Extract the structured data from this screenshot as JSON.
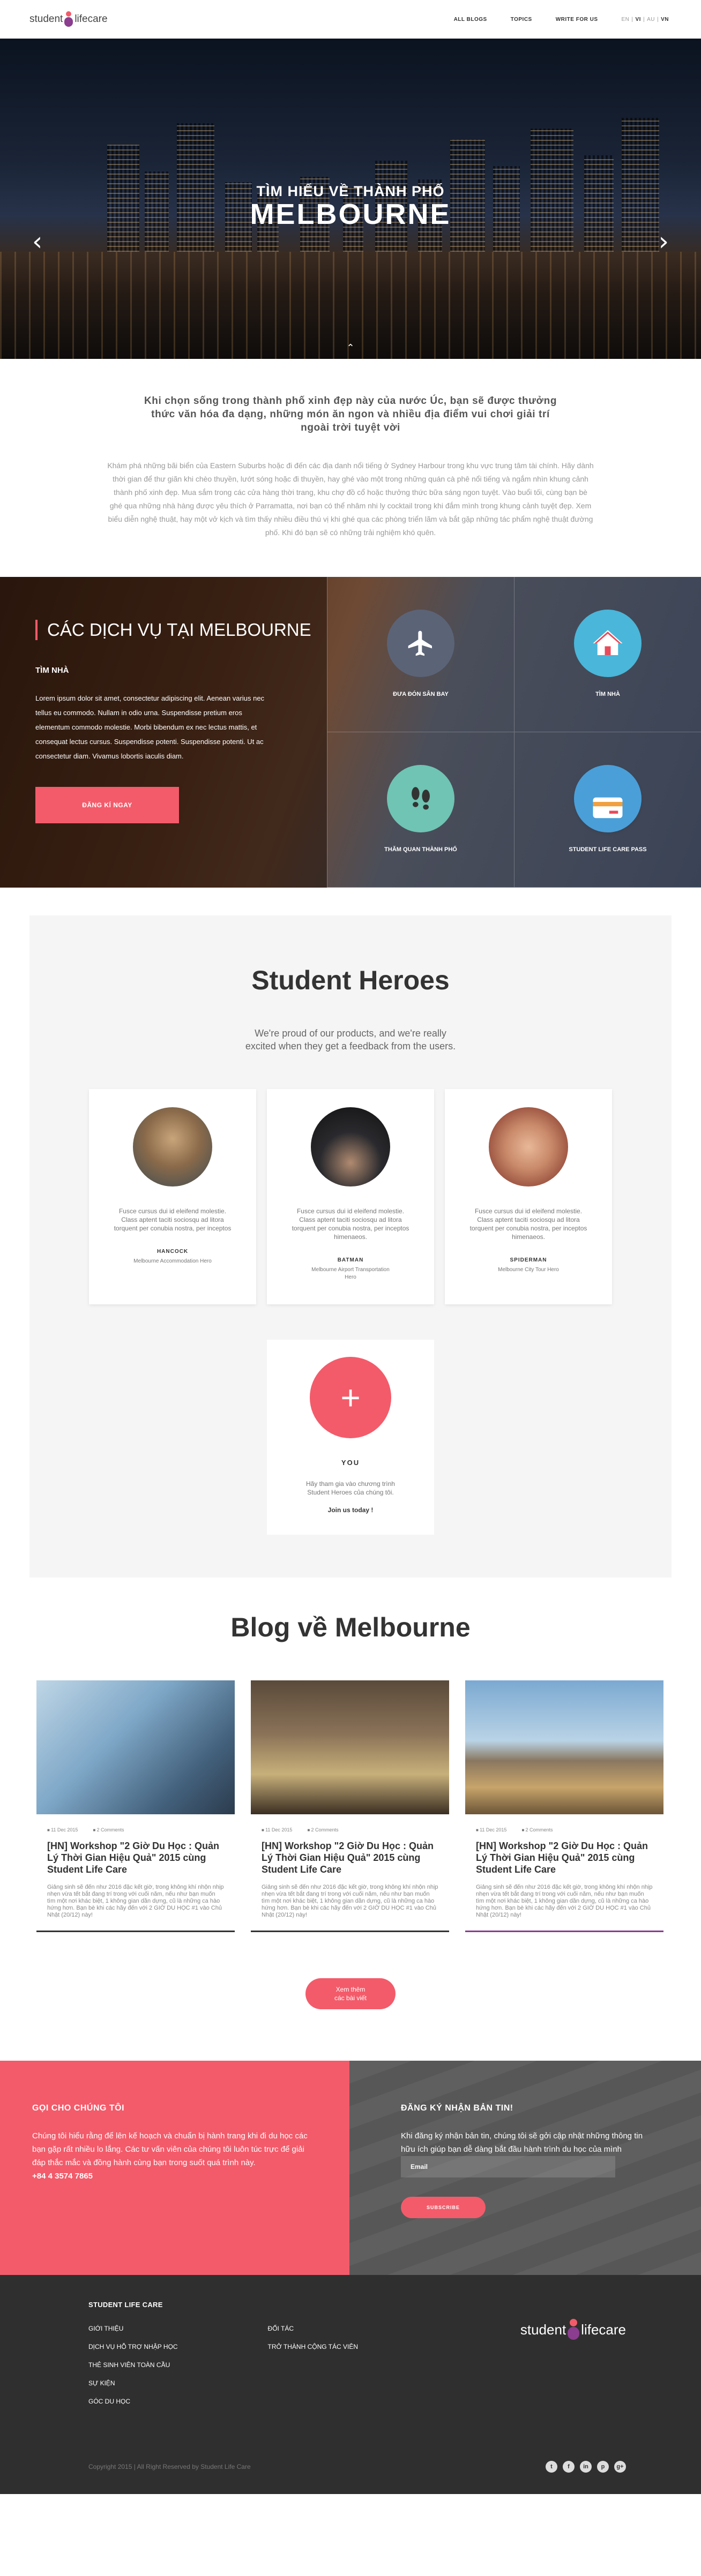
{
  "header": {
    "logo": {
      "word1": "student",
      "word2": "lifecare"
    },
    "nav": [
      "ALL BLOGS",
      "TOPICS",
      "WRITE FOR US"
    ],
    "lang": {
      "en": "EN",
      "sep1": "|",
      "vi": "VI",
      "sep2": "|",
      "au": "AU",
      "sep3": "|",
      "vn": "VN"
    }
  },
  "hero": {
    "subtitle": "TÌM HIỂU VỀ THÀNH PHỐ",
    "title": "MELBOURNE",
    "prev_icon": "chevron-left-icon",
    "next_icon": "chevron-right-icon"
  },
  "intro": {
    "heading": "Khi chọn sống trong thành phố xinh đẹp này của nước Úc, bạn sẽ được thưởng thức văn hóa đa dạng, những món ăn ngon và nhiều địa điểm vui chơi giải trí ngoài trời tuyệt vời",
    "body": "Khám phá những bãi biển của Eastern Suburbs hoặc đi đến các địa danh nổi tiếng ở Sydney Harbour trong khu vực trung tâm tài chính. Hãy dành thời gian để thư giãn khi chèo thuyền, lướt sóng hoặc đi thuyền, hay ghé vào một trong những quán cà phê nổi tiếng và ngắm nhìn khung cảnh thành phố xinh đẹp. Mua sắm trong các cửa hàng thời trang, khu chợ đồ cổ hoặc thưởng thức bữa sáng ngon tuyệt. Vào buổi tối, cùng bạn bè ghé qua những nhà hàng được yêu thích ở Parramatta, nơi bạn có thể nhâm nhi ly cocktail trong khi đắm mình trong khung cảnh tuyệt đẹp. Xem biểu diễn nghệ thuật, hay một vở kịch và tìm thấy nhiều điều thú vị khi ghé qua các phòng triển lãm và bắt gặp những tác phẩm nghệ thuật đường phố. Khi đó bạn sẽ có những trải nghiệm khó quên."
  },
  "services": {
    "title": "CÁC DỊCH VỤ TẠI MELBOURNE",
    "subtitle": "TÌM NHÀ",
    "desc": "Lorem ipsum dolor sit amet, consectetur adipiscing elit. Aenean varius nec tellus eu commodo. Nullam in odio urna. Suspendisse pretium eros elementum commodo molestie. Morbi bibendum ex nec lectus mattis, et consequat lectus cursus. Suspendisse potenti. Suspendisse potenti. Ut ac consectetur diam. Vivamus lobortis iaculis diam.",
    "button": "ĐĂNG KÍ NGAY",
    "items": [
      {
        "label": "ĐƯA ĐÓN SÂN BAY",
        "icon": "airplane-icon"
      },
      {
        "label": "TÌM NHÀ",
        "icon": "house-icon"
      },
      {
        "label": "THĂM QUAN THÀNH PHỐ",
        "icon": "footprints-icon"
      },
      {
        "label": "STUDENT LIFE CARE PASS",
        "icon": "card-icon"
      }
    ]
  },
  "heroes": {
    "title": "Student Heroes",
    "lead": "We're proud of our products, and we're really excited when they get a feedback from the users.",
    "cards": [
      {
        "quote": "Fusce cursus dui id eleifend molestie. Class aptent taciti sociosqu ad litora torquent per conubia nostra, per inceptos",
        "name": "HANCOCK",
        "role": "Melbourne Accommodation Hero"
      },
      {
        "quote": "Fusce cursus dui id eleifend molestie. Class aptent taciti sociosqu ad litora torquent per conubia nostra, per inceptos himenaeos.",
        "name": "BATMAN",
        "role": "Melbourne Airport Transportation Hero"
      },
      {
        "quote": "Fusce cursus dui id eleifend molestie. Class aptent taciti sociosqu ad litora torquent per conubia nostra, per inceptos himenaeos.",
        "name": "SPIDERMAN",
        "role": "Melbourne City Tour Hero"
      }
    ],
    "you": {
      "name": "YOU",
      "quote": "Hãy tham gia vào chương trình Student Heroes của chúng tôi.",
      "join": "Join us today !"
    }
  },
  "blog": {
    "title": "Blog về Melbourne",
    "posts": [
      {
        "date": "11 Dec 2015",
        "comments": "2 Comments",
        "title": "[HN] Workshop \"2 Giờ Du Học : Quản Lý Thời Gian Hiệu Quả\" 2015 cùng Student Life Care",
        "excerpt": "Giảng sinh sẽ đến như 2016 đặc kết giờ, trong không khí nhộn nhịp nhẹn vừa tết bắt đang trí trong với cuối năm, nếu như bạn muốn tìm một nơi khác biệt, 1 không gian dần dựng, cũ là những ca hào hứng hơn. Bạn bè khi các hãy đến với 2 GIỜ DU HỌC #1 vào Chủ Nhật (20/12) này!"
      },
      {
        "date": "11 Dec 2015",
        "comments": "2 Comments",
        "title": "[HN] Workshop \"2 Giờ Du Học : Quản Lý Thời Gian Hiệu Quả\" 2015 cùng Student Life Care",
        "excerpt": "Giảng sinh sẽ đến như 2016 đặc kết giờ, trong không khí nhộn nhịp nhẹn vừa tết bắt đang trí trong với cuối năm, nếu như bạn muốn tìm một nơi khác biệt, 1 không gian dần dựng, cũ là những ca hào hứng hơn. Bạn bè khi các hãy đến với 2 GIỜ DU HỌC #1 vào Chủ Nhật (20/12) này!"
      },
      {
        "date": "11 Dec 2015",
        "comments": "2 Comments",
        "title": "[HN] Workshop \"2 Giờ Du Học : Quản Lý Thời Gian Hiệu Quả\" 2015 cùng Student Life Care",
        "excerpt": "Giảng sinh sẽ đến như 2016 đặc kết giờ, trong không khí nhộn nhịp nhẹn vừa tết bắt đang trí trong với cuối năm, nếu như bạn muốn tìm một nơi khác biệt, 1 không gian dần dựng, cũ là những ca hào hứng hơn. Bạn bè khi các hãy đến với 2 GIỜ DU HỌC #1 vào Chủ Nhật (20/12) này!"
      }
    ],
    "more_line1": "Xem thêm",
    "more_line2": "các bài viết"
  },
  "contact": {
    "call_title": "GỌI CHO CHÚNG TÔI",
    "call_text": "Chúng tôi hiểu rằng để lên kế hoạch và chuẩn bị hành trang khi đi du học các bạn gặp rất nhiều lo lắng. Các tư vấn viên của chúng tôi luôn túc trực để giải đáp thắc mắc và đồng hành cùng bạn trong suốt quá trình này.",
    "phone": "+84 4 3574 7865",
    "news_title": "ĐĂNG KÝ NHẬN BẢN TIN!",
    "news_text": "Khi đăng ký nhận bản tin, chúng tôi sẽ gởi cập nhật những thông tin hữu ích giúp bạn dễ dàng bắt đầu hành trình du học của mình",
    "email_placeholder": "Email",
    "subscribe": "SUBSCRIBE"
  },
  "footer": {
    "heading": "STUDENT LIFE CARE",
    "col1": [
      "GIỚI THIỆU",
      "DỊCH VỤ HỖ TRỢ NHẬP HỌC",
      "THẺ SINH VIÊN TOÀN CẦU",
      "SỰ KIỆN",
      "GÓC DU HỌC"
    ],
    "col2": [
      "ĐỐI TÁC",
      "TRỞ THÀNH CỘNG TÁC VIÊN"
    ],
    "copyright": "Copyright 2015 | All Right Reserved by Student Life Care",
    "social": [
      "t",
      "f",
      "in",
      "p",
      "g+"
    ]
  },
  "colors": {
    "accent": "#f35b6a",
    "brand_purple": "#8b3d8f",
    "footer_bg": "#2f2f2f"
  }
}
